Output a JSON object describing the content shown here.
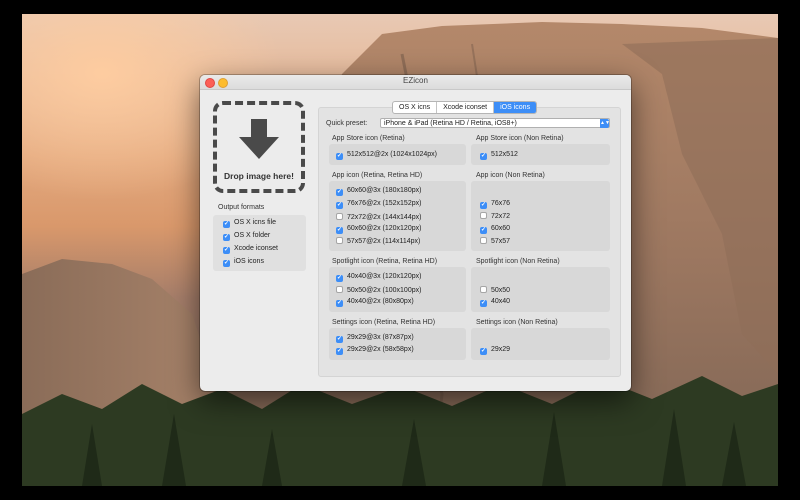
{
  "window": {
    "title": "EZicon"
  },
  "drop_zone": {
    "label": "Drop image here!"
  },
  "output_formats": {
    "title": "Output formats",
    "items": [
      {
        "label": "OS X icns file",
        "checked": true
      },
      {
        "label": "OS X folder",
        "checked": true
      },
      {
        "label": "Xcode iconset",
        "checked": true
      },
      {
        "label": "iOS icons",
        "checked": true
      }
    ]
  },
  "tabs": [
    {
      "label": "OS X icns",
      "active": false
    },
    {
      "label": "Xcode iconset",
      "active": false
    },
    {
      "label": "iOS icons",
      "active": true
    }
  ],
  "quick_preset": {
    "label": "Quick preset:",
    "value": "iPhone & iPad (Retina HD / Retina, iOS8+)"
  },
  "sections": {
    "app_store_retina": {
      "title": "App Store icon (Retina)",
      "items": [
        {
          "label": "512x512@2x (1024x1024px)",
          "checked": true
        }
      ]
    },
    "app_store_non_retina": {
      "title": "App Store icon (Non Retina)",
      "items": [
        {
          "label": "512x512",
          "checked": true
        }
      ]
    },
    "app_retina": {
      "title": "App icon (Retina, Retina HD)",
      "items": [
        {
          "label": "60x60@3x (180x180px)",
          "checked": true
        },
        {
          "label": "76x76@2x (152x152px)",
          "checked": true
        },
        {
          "label": "72x72@2x (144x144px)",
          "checked": false
        },
        {
          "label": "60x60@2x (120x120px)",
          "checked": true
        },
        {
          "label": "57x57@2x (114x114px)",
          "checked": false
        }
      ]
    },
    "app_non_retina": {
      "title": "App icon (Non Retina)",
      "items": [
        {
          "label": "76x76",
          "checked": true
        },
        {
          "label": "72x72",
          "checked": false
        },
        {
          "label": "60x60",
          "checked": true
        },
        {
          "label": "57x57",
          "checked": false
        }
      ]
    },
    "spotlight_retina": {
      "title": "Spotlight icon (Retina, Retina HD)",
      "items": [
        {
          "label": "40x40@3x (120x120px)",
          "checked": true
        },
        {
          "label": "50x50@2x (100x100px)",
          "checked": false
        },
        {
          "label": "40x40@2x (80x80px)",
          "checked": true
        }
      ]
    },
    "spotlight_non_retina": {
      "title": "Spotlight icon (Non Retina)",
      "items": [
        {
          "label": "50x50",
          "checked": false
        },
        {
          "label": "40x40",
          "checked": true
        }
      ]
    },
    "settings_retina": {
      "title": "Settings icon (Retina, Retina HD)",
      "items": [
        {
          "label": "29x29@3x (87x87px)",
          "checked": true
        },
        {
          "label": "29x29@2x (58x58px)",
          "checked": true
        }
      ]
    },
    "settings_non_retina": {
      "title": "Settings icon (Non Retina)",
      "items": [
        {
          "label": "29x29",
          "checked": true
        }
      ]
    }
  },
  "colors": {
    "accent": "#3d8ef7",
    "close": "#fc5f57",
    "minimize": "#fdbc2e"
  }
}
